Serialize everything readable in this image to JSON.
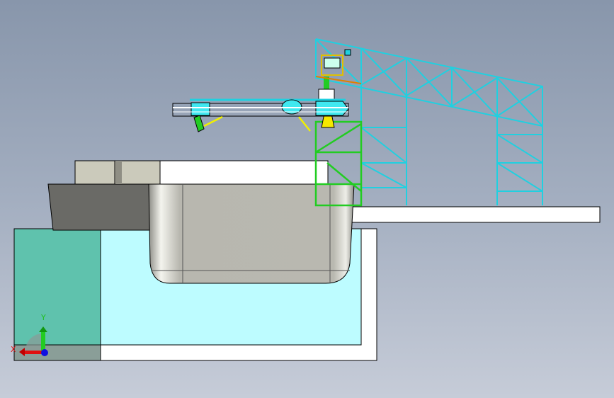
{
  "viewport": {
    "triad": {
      "x_label": "X",
      "y_label": "Y"
    },
    "colors": {
      "x_axis": "#e01010",
      "y_axis": "#20c020",
      "z_axis": "#1010e0",
      "structure_cyan": "#20d0e0",
      "structure_green": "#22cc22",
      "water": "#bdfcff",
      "pit_teal": "#5fc2ad",
      "hull": "#b7b6ae"
    }
  }
}
